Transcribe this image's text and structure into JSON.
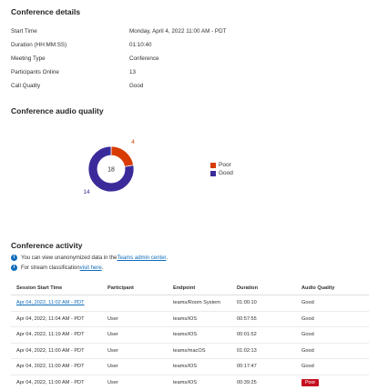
{
  "conference_details": {
    "title": "Conference details",
    "rows": [
      {
        "label": "Start Time",
        "value": "Monday, April 4, 2022 11:00 AM - PDT"
      },
      {
        "label": "Duration (HH:MM:SS)",
        "value": "01:10:40"
      },
      {
        "label": "Meeting Type",
        "value": "Conference"
      },
      {
        "label": "Participants Online",
        "value": "13"
      },
      {
        "label": "Call Quality",
        "value": "Good"
      }
    ]
  },
  "audio_quality": {
    "title": "Conference audio quality",
    "total": "18",
    "poor_count": "4",
    "good_count": "14",
    "legend": [
      {
        "label": "Poor",
        "color": "#d83b01"
      },
      {
        "label": "Good",
        "color": "#3b2b9a"
      }
    ]
  },
  "chart_data": {
    "type": "pie",
    "title": "",
    "categories": [
      "Poor",
      "Good"
    ],
    "values": [
      4,
      14
    ],
    "colors": [
      "#d83b01",
      "#3b2b9a"
    ],
    "center_label": "18",
    "legend_position": "right"
  },
  "activity": {
    "title": "Conference activity",
    "info1": {
      "prefix": "You can view unanonymized data in the ",
      "link": "Teams admin center",
      "suffix": "."
    },
    "info2": {
      "prefix": "For stream classification ",
      "link": "visit here",
      "suffix": "."
    },
    "columns": [
      "Session Start Time",
      "Participant",
      "Endpoint",
      "Duration",
      "Audio Quality"
    ],
    "rows": [
      {
        "start": "Apr 04, 2022, 11:02 AM - PDT",
        "participant": "",
        "endpoint": "teams/Room System",
        "duration": "01:00:10",
        "quality": "Good"
      },
      {
        "start": "Apr 04, 2022, 11:04 AM - PDT",
        "participant": "User",
        "endpoint": "teams/iOS",
        "duration": "00:57:55",
        "quality": "Good"
      },
      {
        "start": "Apr 04, 2022, 11:19 AM - PDT",
        "participant": "User",
        "endpoint": "teams/iOS",
        "duration": "00:01:52",
        "quality": "Good"
      },
      {
        "start": "Apr 04, 2022, 11:00 AM - PDT",
        "participant": "User",
        "endpoint": "teams/macOS",
        "duration": "01:02:13",
        "quality": "Good"
      },
      {
        "start": "Apr 04, 2022, 11:00 AM - PDT",
        "participant": "User",
        "endpoint": "teams/iOS",
        "duration": "00:17:47",
        "quality": "Good"
      },
      {
        "start": "Apr 04, 2022, 11:00 AM - PDT",
        "participant": "User",
        "endpoint": "teams/iOS",
        "duration": "00:39:25",
        "quality": "Poor"
      }
    ]
  }
}
